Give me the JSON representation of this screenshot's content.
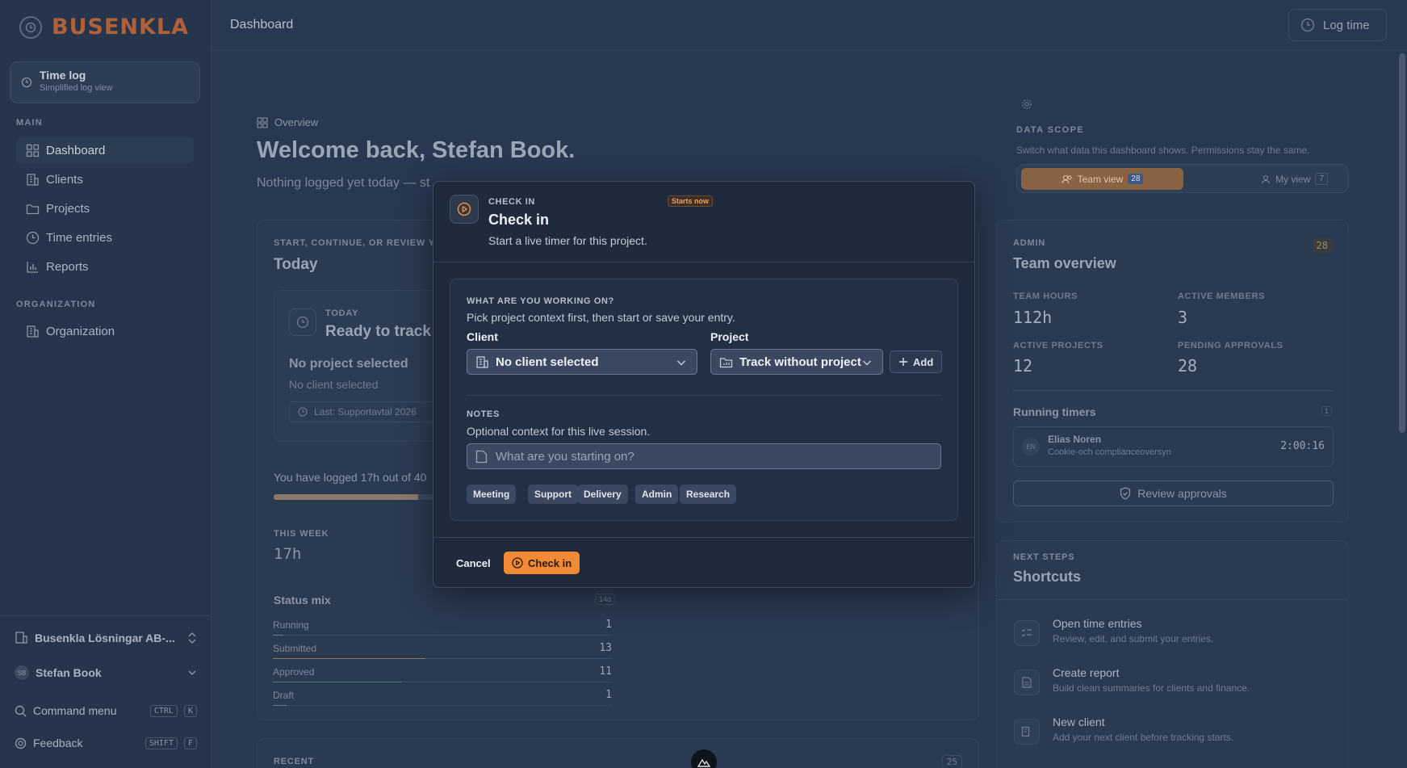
{
  "app": {
    "logo_text": "BUSENKLA",
    "page_title": "Dashboard",
    "log_time_label": "Log time"
  },
  "sidebar": {
    "timelog": {
      "title": "Time log",
      "subtitle": "Simplified log view"
    },
    "main_label": "MAIN",
    "main_items": [
      {
        "label": "Dashboard",
        "icon": "dashboard-icon",
        "active": true
      },
      {
        "label": "Clients",
        "icon": "building-icon"
      },
      {
        "label": "Projects",
        "icon": "folder-icon"
      },
      {
        "label": "Time entries",
        "icon": "clock-icon"
      },
      {
        "label": "Reports",
        "icon": "chart-icon"
      }
    ],
    "org_label": "ORGANIZATION",
    "org_items": [
      {
        "label": "Organization",
        "icon": "building-icon"
      }
    ],
    "workspace": "Busenkla Lösningar AB-...",
    "user_initials": "SB",
    "user_name": "Stefan Book",
    "command_menu": {
      "label": "Command menu",
      "keys": [
        "CTRL",
        "K"
      ]
    },
    "feedback": {
      "label": "Feedback",
      "keys": [
        "SHIFT",
        "F"
      ]
    }
  },
  "main": {
    "breadcrumb": "Overview",
    "welcome": "Welcome back, Stefan Book.",
    "subtitle": "Nothing logged yet today — st",
    "today_card": {
      "kicker": "START, CONTINUE, OR REVIEW YOU",
      "title": "Today",
      "inner_kicker": "TODAY",
      "inner_title": "Ready to track",
      "project": "No project selected",
      "client": "No client selected",
      "last": "Last: Supportavtal 2026"
    },
    "logged_text": "You have logged 17h out of 40",
    "logged_progress": 0.425,
    "week_label": "THIS WEEK",
    "week_value": "17h",
    "status_mix": {
      "title": "Status mix",
      "badge": "14d",
      "rows": [
        {
          "label": "Running",
          "value": "1",
          "fraction": 0.03,
          "color": "#6a7a90"
        },
        {
          "label": "Submitted",
          "value": "13",
          "fraction": 0.45,
          "color": "#8a7a5a"
        },
        {
          "label": "Approved",
          "value": "11",
          "fraction": 0.38,
          "color": "#4a7a70"
        },
        {
          "label": "Draft",
          "value": "1",
          "fraction": 0.04,
          "color": "#6a7a90"
        }
      ]
    },
    "recent_label": "RECENT",
    "recent_count": "25"
  },
  "right": {
    "scope_label": "DATA SCOPE",
    "scope_sub": "Switch what data this dashboard shows. Permissions stay the same.",
    "team_view": {
      "label": "Team view",
      "count": "28"
    },
    "my_view": {
      "label": "My view",
      "count": "7"
    },
    "admin_kicker": "ADMIN",
    "admin_title": "Team overview",
    "admin_badge": "28",
    "stats": [
      {
        "label": "TEAM HOURS",
        "value": "112h"
      },
      {
        "label": "ACTIVE MEMBERS",
        "value": "3"
      },
      {
        "label": "ACTIVE PROJECTS",
        "value": "12"
      },
      {
        "label": "PENDING APPROVALS",
        "value": "28"
      }
    ],
    "running_title": "Running timers",
    "running_count": "1",
    "timer": {
      "initials": "EN",
      "name": "Elias Noren",
      "project": "Cookie-och complianceoversyn",
      "time": "2:00:16"
    },
    "review_label": "Review approvals",
    "next_kicker": "NEXT STEPS",
    "next_title": "Shortcuts",
    "shortcuts": [
      {
        "title": "Open time entries",
        "sub": "Review, edit, and submit your entries."
      },
      {
        "title": "Create report",
        "sub": "Build clean summaries for clients and finance."
      },
      {
        "title": "New client",
        "sub": "Add your next client before tracking starts."
      }
    ]
  },
  "modal": {
    "tag": "CHECK IN",
    "pill": "Starts now",
    "title": "Check in",
    "subtitle": "Start a live timer for this project.",
    "working_label": "WHAT ARE YOU WORKING ON?",
    "working_desc": "Pick project context first, then start or save your entry.",
    "client_label": "Client",
    "client_value": "No client selected",
    "project_label": "Project",
    "project_value": "Track without project",
    "add_label": "Add",
    "notes_label": "NOTES",
    "notes_desc": "Optional context for this live session.",
    "notes_placeholder": "What are you starting on?",
    "chips": [
      "Meeting",
      "Support",
      "Delivery",
      "Admin",
      "Research"
    ],
    "cancel_label": "Cancel",
    "submit_label": "Check in"
  },
  "colors": {
    "accent": "#f08a34",
    "brand": "#b0613a"
  }
}
